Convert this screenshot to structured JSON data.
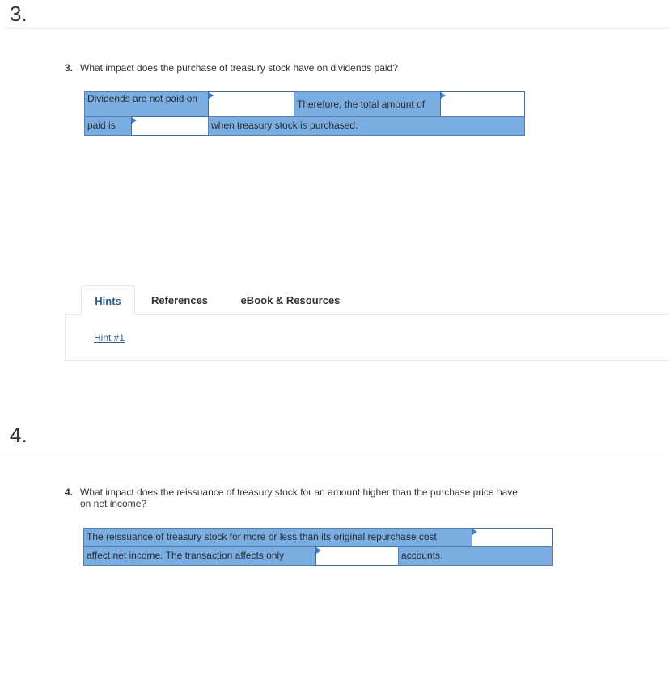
{
  "sections": [
    {
      "number": "3.",
      "question": {
        "num": "3.",
        "text": "What impact does the purchase of treasury stock have on dividends paid?"
      },
      "fill_in": {
        "row1": {
          "text1": "Dividends are not paid on",
          "text2": "Therefore, the total amount of"
        },
        "row2": {
          "text1": "paid is",
          "text2": "when treasury stock is purchased."
        },
        "inputs": [
          {
            "value": "",
            "placeholder": ""
          },
          {
            "value": "",
            "placeholder": ""
          },
          {
            "value": "",
            "placeholder": ""
          }
        ]
      },
      "tabs": [
        {
          "label": "Hints",
          "active": true
        },
        {
          "label": "References",
          "active": false
        },
        {
          "label": "eBook & Resources",
          "active": false
        }
      ],
      "hint_link": "Hint #1"
    },
    {
      "number": "4.",
      "question": {
        "num": "4.",
        "line1": "What impact does the reissuance of treasury stock for an amount higher than the purchase price have",
        "line2": "on net income?"
      },
      "fill_in": {
        "row1": {
          "text1": "The reissuance of treasury stock for more or less than its original repurchase cost"
        },
        "row2": {
          "text1": "affect net income. The transaction affects only",
          "text2": "accounts."
        },
        "inputs": [
          {
            "value": "",
            "placeholder": ""
          },
          {
            "value": "",
            "placeholder": ""
          }
        ]
      }
    }
  ],
  "colors": {
    "cell_bg": "#7aade2",
    "cell_border": "#5c7fa8",
    "input_border": "#3d6ea3",
    "marker": "#3d7dd6",
    "link": "#2f5c8a"
  }
}
